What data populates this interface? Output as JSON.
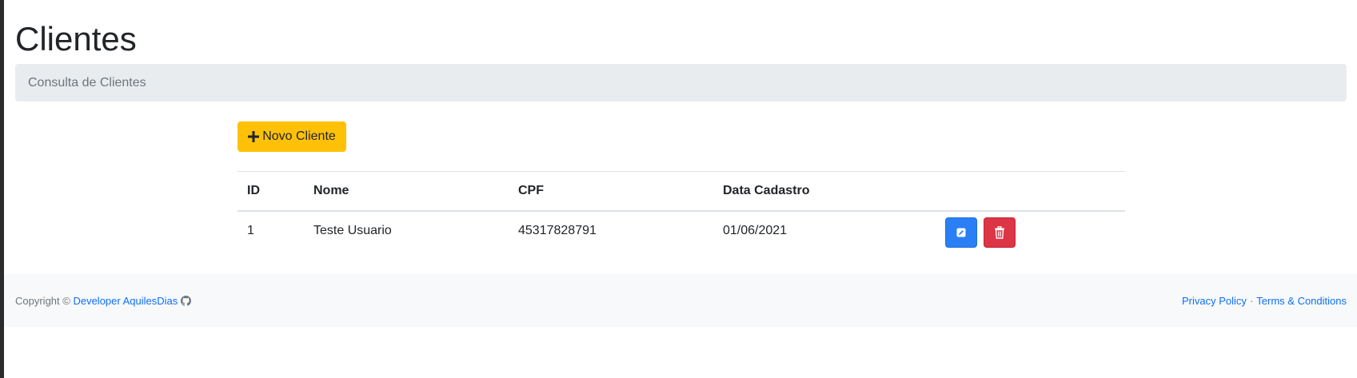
{
  "page": {
    "title": "Clientes",
    "breadcrumb": "Consulta de Clientes"
  },
  "toolbar": {
    "new_label": "Novo Cliente",
    "new_icon": "plus-icon"
  },
  "table": {
    "headers": [
      "ID",
      "Nome",
      "CPF",
      "Data Cadastro",
      ""
    ],
    "rows": [
      {
        "id": "1",
        "nome": "Teste Usuario",
        "cpf": "45317828791",
        "data": "01/06/2021"
      }
    ],
    "edit_icon": "edit-icon",
    "delete_icon": "trash-icon"
  },
  "footer": {
    "copyright": "Copyright ©",
    "developer_link": "Developer AquilesDias",
    "github_icon": "github-icon",
    "privacy": "Privacy Policy",
    "separator": "·",
    "terms": "Terms & Conditions"
  },
  "colors": {
    "primary": "#2a7ff5",
    "danger": "#dc3545",
    "warning": "#ffc107",
    "link": "#0d6efd"
  }
}
